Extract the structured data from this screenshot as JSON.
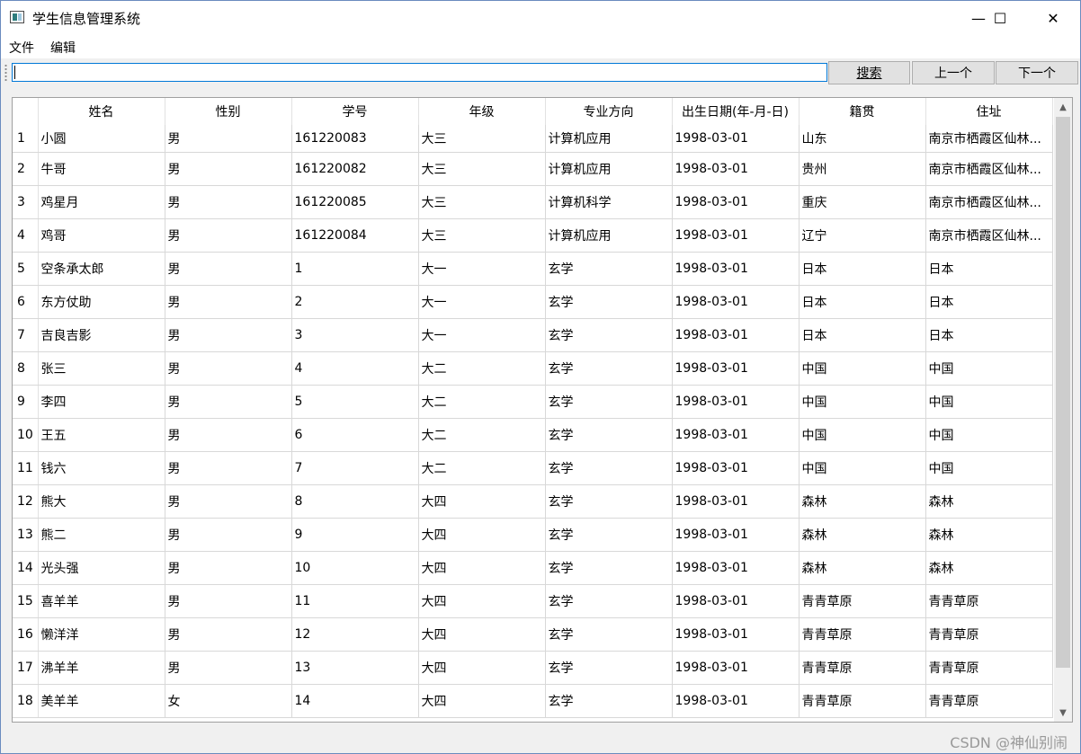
{
  "window": {
    "title": "学生信息管理系统",
    "minimize": "—",
    "maximize": "☐",
    "close": "✕"
  },
  "menu": [
    "文件",
    "编辑"
  ],
  "toolbar": {
    "search_value": "",
    "search_button": "搜索",
    "prev_button": "上一个",
    "next_button": "下一个"
  },
  "table": {
    "columns": [
      "姓名",
      "性别",
      "学号",
      "年级",
      "专业方向",
      "出生日期(年-月-日)",
      "籍贯",
      "住址"
    ],
    "rows": [
      {
        "n": "1",
        "cells": [
          "小圆",
          "男",
          "161220083",
          "大三",
          "计算机应用",
          "1998-03-01",
          "山东",
          "南京市栖霞区仙林..."
        ]
      },
      {
        "n": "2",
        "cells": [
          "牛哥",
          "男",
          "161220082",
          "大三",
          "计算机应用",
          "1998-03-01",
          "贵州",
          "南京市栖霞区仙林..."
        ]
      },
      {
        "n": "3",
        "cells": [
          "鸡星月",
          "男",
          "161220085",
          "大三",
          "计算机科学",
          "1998-03-01",
          "重庆",
          "南京市栖霞区仙林..."
        ]
      },
      {
        "n": "4",
        "cells": [
          "鸡哥",
          "男",
          "161220084",
          "大三",
          "计算机应用",
          "1998-03-01",
          "辽宁",
          "南京市栖霞区仙林..."
        ]
      },
      {
        "n": "5",
        "cells": [
          "空条承太郎",
          "男",
          "1",
          "大一",
          "玄学",
          "1998-03-01",
          "日本",
          "日本"
        ]
      },
      {
        "n": "6",
        "cells": [
          "东方仗助",
          "男",
          "2",
          "大一",
          "玄学",
          "1998-03-01",
          "日本",
          "日本"
        ]
      },
      {
        "n": "7",
        "cells": [
          "吉良吉影",
          "男",
          "3",
          "大一",
          "玄学",
          "1998-03-01",
          "日本",
          "日本"
        ]
      },
      {
        "n": "8",
        "cells": [
          "张三",
          "男",
          "4",
          "大二",
          "玄学",
          "1998-03-01",
          "中国",
          "中国"
        ]
      },
      {
        "n": "9",
        "cells": [
          "李四",
          "男",
          "5",
          "大二",
          "玄学",
          "1998-03-01",
          "中国",
          "中国"
        ]
      },
      {
        "n": "10",
        "cells": [
          "王五",
          "男",
          "6",
          "大二",
          "玄学",
          "1998-03-01",
          "中国",
          "中国"
        ]
      },
      {
        "n": "11",
        "cells": [
          "钱六",
          "男",
          "7",
          "大二",
          "玄学",
          "1998-03-01",
          "中国",
          "中国"
        ]
      },
      {
        "n": "12",
        "cells": [
          "熊大",
          "男",
          "8",
          "大四",
          "玄学",
          "1998-03-01",
          "森林",
          "森林"
        ]
      },
      {
        "n": "13",
        "cells": [
          "熊二",
          "男",
          "9",
          "大四",
          "玄学",
          "1998-03-01",
          "森林",
          "森林"
        ]
      },
      {
        "n": "14",
        "cells": [
          "光头强",
          "男",
          "10",
          "大四",
          "玄学",
          "1998-03-01",
          "森林",
          "森林"
        ]
      },
      {
        "n": "15",
        "cells": [
          "喜羊羊",
          "男",
          "11",
          "大四",
          "玄学",
          "1998-03-01",
          "青青草原",
          "青青草原"
        ]
      },
      {
        "n": "16",
        "cells": [
          "懒洋洋",
          "男",
          "12",
          "大四",
          "玄学",
          "1998-03-01",
          "青青草原",
          "青青草原"
        ]
      },
      {
        "n": "17",
        "cells": [
          "沸羊羊",
          "男",
          "13",
          "大四",
          "玄学",
          "1998-03-01",
          "青青草原",
          "青青草原"
        ]
      },
      {
        "n": "18",
        "cells": [
          "美羊羊",
          "女",
          "14",
          "大四",
          "玄学",
          "1998-03-01",
          "青青草原",
          "青青草原"
        ]
      }
    ]
  },
  "watermark": "CSDN @神仙别闹"
}
